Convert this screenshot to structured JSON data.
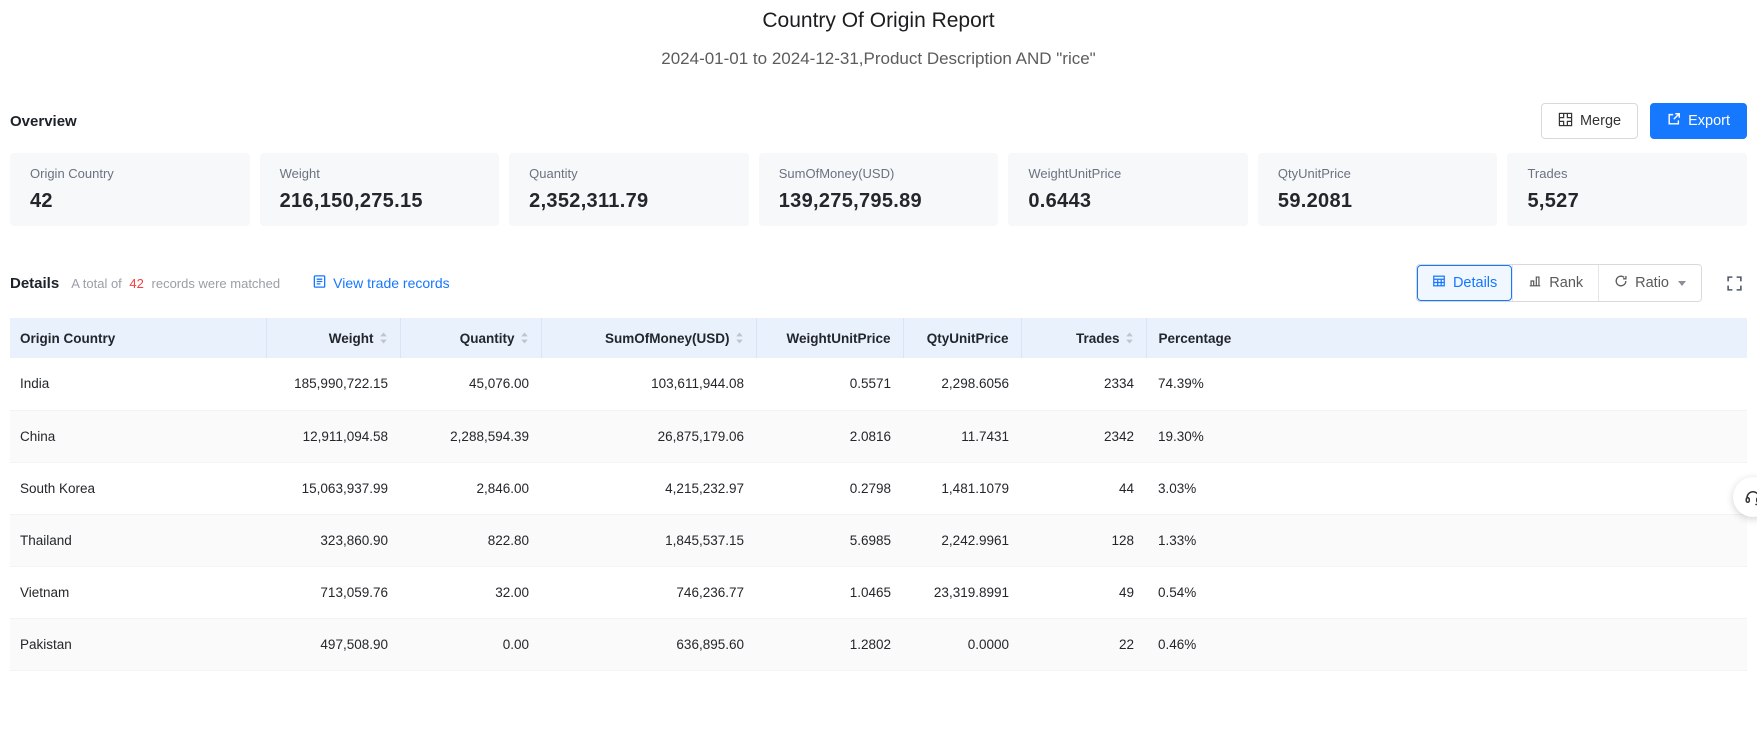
{
  "header": {
    "title": "Country Of Origin Report",
    "subtitle": "2024-01-01 to 2024-12-31,Product Description AND \"rice\""
  },
  "overview": {
    "label": "Overview",
    "merge_label": "Merge",
    "export_label": "Export",
    "cards": [
      {
        "label": "Origin Country",
        "value": "42"
      },
      {
        "label": "Weight",
        "value": "216,150,275.15"
      },
      {
        "label": "Quantity",
        "value": "2,352,311.79"
      },
      {
        "label": "SumOfMoney(USD)",
        "value": "139,275,795.89"
      },
      {
        "label": "WeightUnitPrice",
        "value": "0.6443"
      },
      {
        "label": "QtyUnitPrice",
        "value": "59.2081"
      },
      {
        "label": "Trades",
        "value": "5,527"
      }
    ]
  },
  "details": {
    "label": "Details",
    "summary_prefix": "A total of",
    "summary_count": "42",
    "summary_suffix": "records were matched",
    "view_link": "View trade records",
    "tab_details": "Details",
    "tab_rank": "Rank",
    "tab_ratio": "Ratio"
  },
  "table": {
    "columns": [
      {
        "label": "Origin Country"
      },
      {
        "label": "Weight"
      },
      {
        "label": "Quantity"
      },
      {
        "label": "SumOfMoney(USD)"
      },
      {
        "label": "WeightUnitPrice"
      },
      {
        "label": "QtyUnitPrice"
      },
      {
        "label": "Trades"
      },
      {
        "label": "Percentage"
      }
    ],
    "rows": [
      [
        "India",
        "185,990,722.15",
        "45,076.00",
        "103,611,944.08",
        "0.5571",
        "2,298.6056",
        "2334",
        "74.39%"
      ],
      [
        "China",
        "12,911,094.58",
        "2,288,594.39",
        "26,875,179.06",
        "2.0816",
        "11.7431",
        "2342",
        "19.30%"
      ],
      [
        "South Korea",
        "15,063,937.99",
        "2,846.00",
        "4,215,232.97",
        "0.2798",
        "1,481.1079",
        "44",
        "3.03%"
      ],
      [
        "Thailand",
        "323,860.90",
        "822.80",
        "1,845,537.15",
        "5.6985",
        "2,242.9961",
        "128",
        "1.33%"
      ],
      [
        "Vietnam",
        "713,059.76",
        "32.00",
        "746,236.77",
        "1.0465",
        "23,319.8991",
        "49",
        "0.54%"
      ],
      [
        "Pakistan",
        "497,508.90",
        "0.00",
        "636,895.60",
        "1.2802",
        "0.0000",
        "22",
        "0.46%"
      ]
    ]
  },
  "colors": {
    "accent": "#1677ff",
    "count_red": "#f53f3f",
    "table_header_bg": "#e9f1fd",
    "card_bg": "#f7f8fa"
  }
}
